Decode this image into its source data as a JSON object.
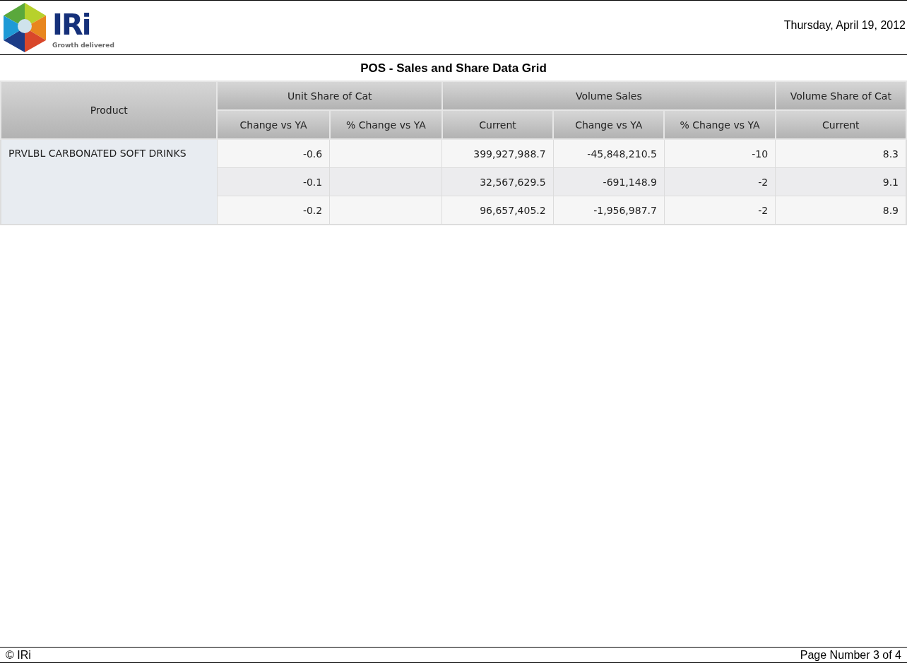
{
  "header": {
    "logo_text": "IRi",
    "tagline": "Growth delivered",
    "date": "Thursday, April 19, 2012"
  },
  "title": "POS - Sales and Share Data Grid",
  "table": {
    "groups": [
      {
        "label": "Product"
      },
      {
        "label": "Unit Share of Cat",
        "columns": [
          "Change vs YA",
          "% Change vs YA"
        ]
      },
      {
        "label": "Volume Sales",
        "columns": [
          "Current",
          "Change vs YA",
          "% Change vs YA"
        ]
      },
      {
        "label": "Volume Share of Cat",
        "columns": [
          "Current"
        ]
      }
    ],
    "product": "PRVLBL CARBONATED SOFT DRINKS",
    "rows": [
      [
        "-0.6",
        null,
        "399,927,988.7",
        "-45,848,210.5",
        "-10",
        "8.3"
      ],
      [
        "-0.1",
        null,
        "32,567,629.5",
        "-691,148.9",
        "-2",
        "9.1"
      ],
      [
        "-0.2",
        null,
        "96,657,405.2",
        "-1,956,987.7",
        "-2",
        "8.9"
      ]
    ]
  },
  "footer": {
    "copyright": "© IRi",
    "page": "Page Number 3 of 4"
  }
}
